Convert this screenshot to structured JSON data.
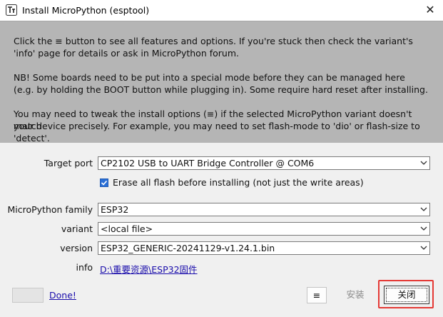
{
  "window": {
    "title": "Install MicroPython (esptool)",
    "close_icon": "close-icon",
    "app_icon": "thonny-app-icon"
  },
  "info": {
    "p1_line1": "Click the ≡ button to see all features and options. If you're stuck then check the variant's",
    "p1_line2": "'info' page for details or ask in MicroPython forum.",
    "p2_line1": "NB! Some boards need to be put into a special mode before they can be managed here",
    "p2_line2": "(e.g. by holding the BOOT button while plugging in). Some require hard reset after installing.",
    "p3_line1": "You may need to tweak the install options (≡) if the selected MicroPython variant doesn't match",
    "p3_line2": "your device precisely. For example, you may need to set flash-mode to 'dio' or flash-size to 'detect'."
  },
  "form": {
    "target_port_label": "Target port",
    "target_port_value": "CP2102 USB to UART Bridge Controller @ COM6",
    "erase_label": "Erase all flash before installing (not just the write areas)",
    "erase_checked": true,
    "family_label": "MicroPython family",
    "family_value": "ESP32",
    "variant_label": "variant",
    "variant_value": "<local file>",
    "version_label": "version",
    "version_value": "ESP32_GENERIC-20241129-v1.24.1.bin",
    "info_label": "info",
    "info_link": "D:\\重要资源\\ESP32固件"
  },
  "footer": {
    "done_link": "Done!",
    "menu_button": "≡",
    "install_button": "安装",
    "close_button": "关闭"
  },
  "colors": {
    "panel_bg": "#b5b5b5",
    "checkbox_accent": "#2a6fd6",
    "link": "#1a0dab",
    "highlight": "#e53935"
  }
}
